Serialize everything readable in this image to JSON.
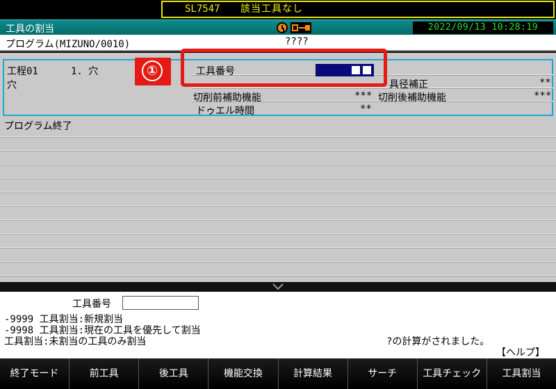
{
  "alarm": {
    "code": "SL7547",
    "message": "該当工具なし"
  },
  "header": {
    "title": "工具の割当",
    "datetime": "2022/09/13 10:28:19",
    "icons": [
      "clock-icon",
      "link-icon"
    ]
  },
  "program": {
    "name": "プログラム(MIZUNO/0010)",
    "status": "????"
  },
  "process": {
    "label": "工程01",
    "step": "1. 穴",
    "type": "穴",
    "tool_number_label": "工具番号",
    "tool_diameter_label": "具径補正",
    "tool_diameter_value": "**",
    "pre_cut_label": "切削前補助機能",
    "pre_cut_value": "***",
    "post_cut_label": "切削後補助機能",
    "post_cut_value": "***",
    "dwell_label": "ドゥエル時間",
    "dwell_value": "**"
  },
  "program_end": "プログラム終了",
  "callout": {
    "number": "①",
    "color": "#e41b14"
  },
  "input_area": {
    "field_label": "工具番号",
    "field_value": "",
    "lines": [
      "-9999 工具割当:新規割当",
      "-9998 工具割当:現在の工具を優先して割当",
      "工具割当:未割当の工具のみ割当"
    ],
    "calc_message": "?の計算がされました。",
    "help": "【ヘルプ】"
  },
  "softkeys": [
    "終了モード",
    "前工具",
    "後工具",
    "機能交換",
    "計算結果",
    "サーチ",
    "工具チェック",
    "工具割当"
  ],
  "colors": {
    "accent": "#0e8c8c",
    "alarm": "#f2f000",
    "clock": "#27e027",
    "highlight": "#1ea5d8"
  }
}
